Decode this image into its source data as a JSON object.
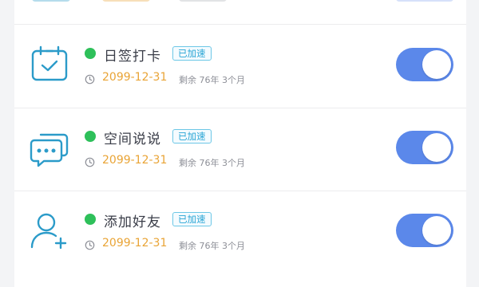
{
  "colors": {
    "accent": "#5b88ea",
    "icon": "#2b9bc9",
    "status_dot": "#2ec05a",
    "date": "#e9a436",
    "badge": "#27a4d4"
  },
  "items": [
    {
      "icon": "calendar-check-icon",
      "name": "日签打卡",
      "badge": "已加速",
      "date": "2099-12-31",
      "remaining": "剩余 76年 3个月",
      "enabled": true
    },
    {
      "icon": "chat-bubbles-icon",
      "name": "空间说说",
      "badge": "已加速",
      "date": "2099-12-31",
      "remaining": "剩余 76年 3个月",
      "enabled": true
    },
    {
      "icon": "add-user-icon",
      "name": "添加好友",
      "badge": "已加速",
      "date": "2099-12-31",
      "remaining": "剩余 76年 3个月",
      "enabled": true
    }
  ]
}
